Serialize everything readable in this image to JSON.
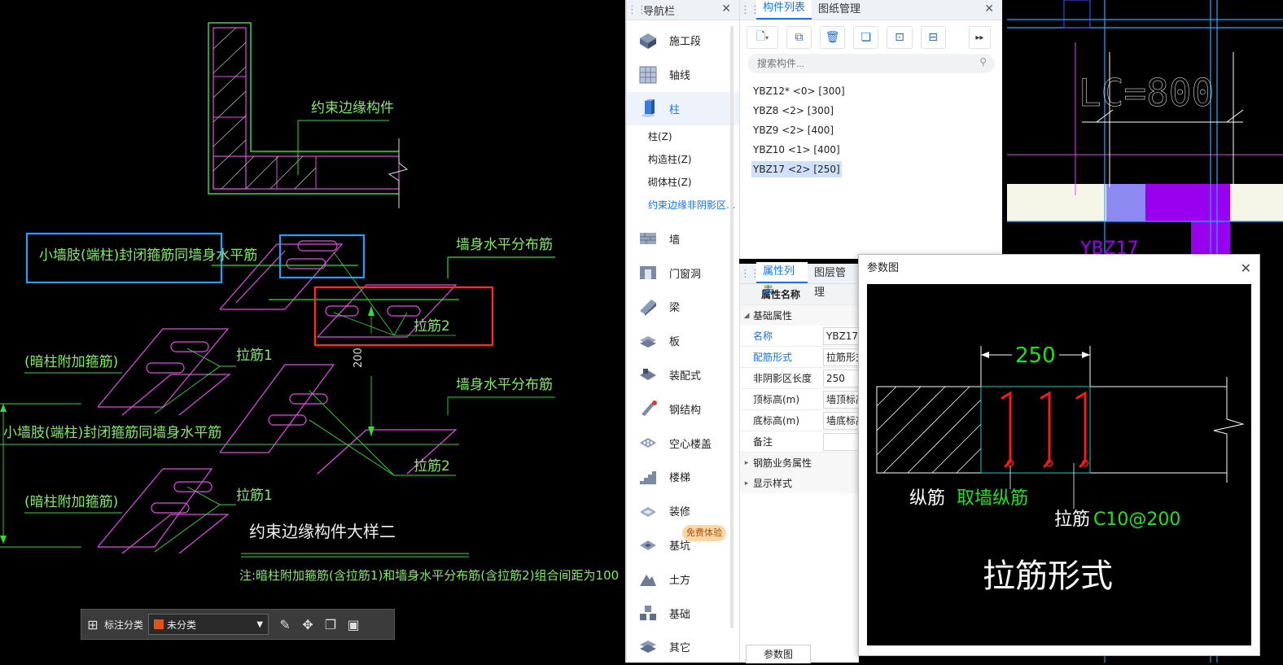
{
  "cad_left": {
    "labels": {
      "constraint_edge": "约束边缘构件",
      "small_pier_closed": "小墙肢(端柱)封闭箍筋同墙身水平筋",
      "wall_horizontal": "墙身水平分布筋",
      "tie2": "拉筋2",
      "dim_200": "200",
      "hidden_col": "(暗柱附加箍筋)",
      "tie1": "拉筋1",
      "detail_title": "约束边缘构件大样二",
      "note": "注:暗柱附加箍筋(含拉筋1)和墙身水平分布筋(含拉筋2)组合间距为100"
    },
    "annotation_toolbar": {
      "label": "标注分类",
      "selected": "未分类",
      "swatch_color": "#e0531b"
    }
  },
  "nav_panel": {
    "title": "导航栏",
    "items_top": [
      {
        "label": "施工段",
        "icon": "construction-stage-icon"
      },
      {
        "label": "轴线",
        "icon": "axis-grid-icon"
      },
      {
        "label": "柱",
        "icon": "column-icon"
      }
    ],
    "sub_items": [
      "柱(Z)",
      "构造柱(Z)",
      "砌体柱(Z)",
      "约束边缘非阴影区..."
    ],
    "items_bottom": [
      {
        "label": "墙",
        "icon": "wall-icon"
      },
      {
        "label": "门窗洞",
        "icon": "door-window-icon"
      },
      {
        "label": "梁",
        "icon": "beam-icon"
      },
      {
        "label": "板",
        "icon": "slab-icon"
      },
      {
        "label": "装配式",
        "icon": "prefab-icon"
      },
      {
        "label": "钢结构",
        "icon": "steel-structure-icon"
      },
      {
        "label": "空心楼盖",
        "icon": "hollow-floor-icon"
      },
      {
        "label": "楼梯",
        "icon": "stair-icon"
      },
      {
        "label": "装修",
        "icon": "decoration-icon"
      },
      {
        "label": "基坑",
        "icon": "pit-icon"
      },
      {
        "label": "土方",
        "icon": "earthwork-icon"
      },
      {
        "label": "基础",
        "icon": "foundation-icon"
      },
      {
        "label": "其它",
        "icon": "other-icon"
      }
    ],
    "free_trial": "免费体验"
  },
  "component_panel": {
    "tabs": [
      "构件列表",
      "图纸管理"
    ],
    "search_placeholder": "搜索构件...",
    "items": [
      "YBZ12* <0> [300]",
      "YBZ8 <2> [300]",
      "YBZ9 <2> [400]",
      "YBZ10 <1> [400]",
      "YBZ17 <2> [250]"
    ],
    "selected_index": 4
  },
  "property_panel": {
    "tabs": [
      "属性列表",
      "图层管理"
    ],
    "header": "属性名称",
    "group_basic": "基础属性",
    "rows": [
      {
        "name": "名称",
        "value": "YBZ17"
      },
      {
        "name": "配筋形式",
        "value": "拉筋形式"
      },
      {
        "name": "非阴影区长度",
        "value": "250"
      },
      {
        "name": "顶标高(m)",
        "value": "墙顶标高"
      },
      {
        "name": "底标高(m)",
        "value": "墙底标高"
      },
      {
        "name": "备注",
        "value": ""
      }
    ],
    "group_business": "钢筋业务属性",
    "group_display": "显示样式",
    "bottom_tab": "参数图"
  },
  "cad_right": {
    "label_lc": "LC=800",
    "label_ybz": "YBZ17"
  },
  "param_dialog": {
    "title": "参数图",
    "dim": "250",
    "long_bar_label": "纵筋",
    "long_bar_value": "取墙纵筋",
    "tie_label": "拉筋",
    "tie_value": "C10@200",
    "form_title": "拉筋形式"
  }
}
